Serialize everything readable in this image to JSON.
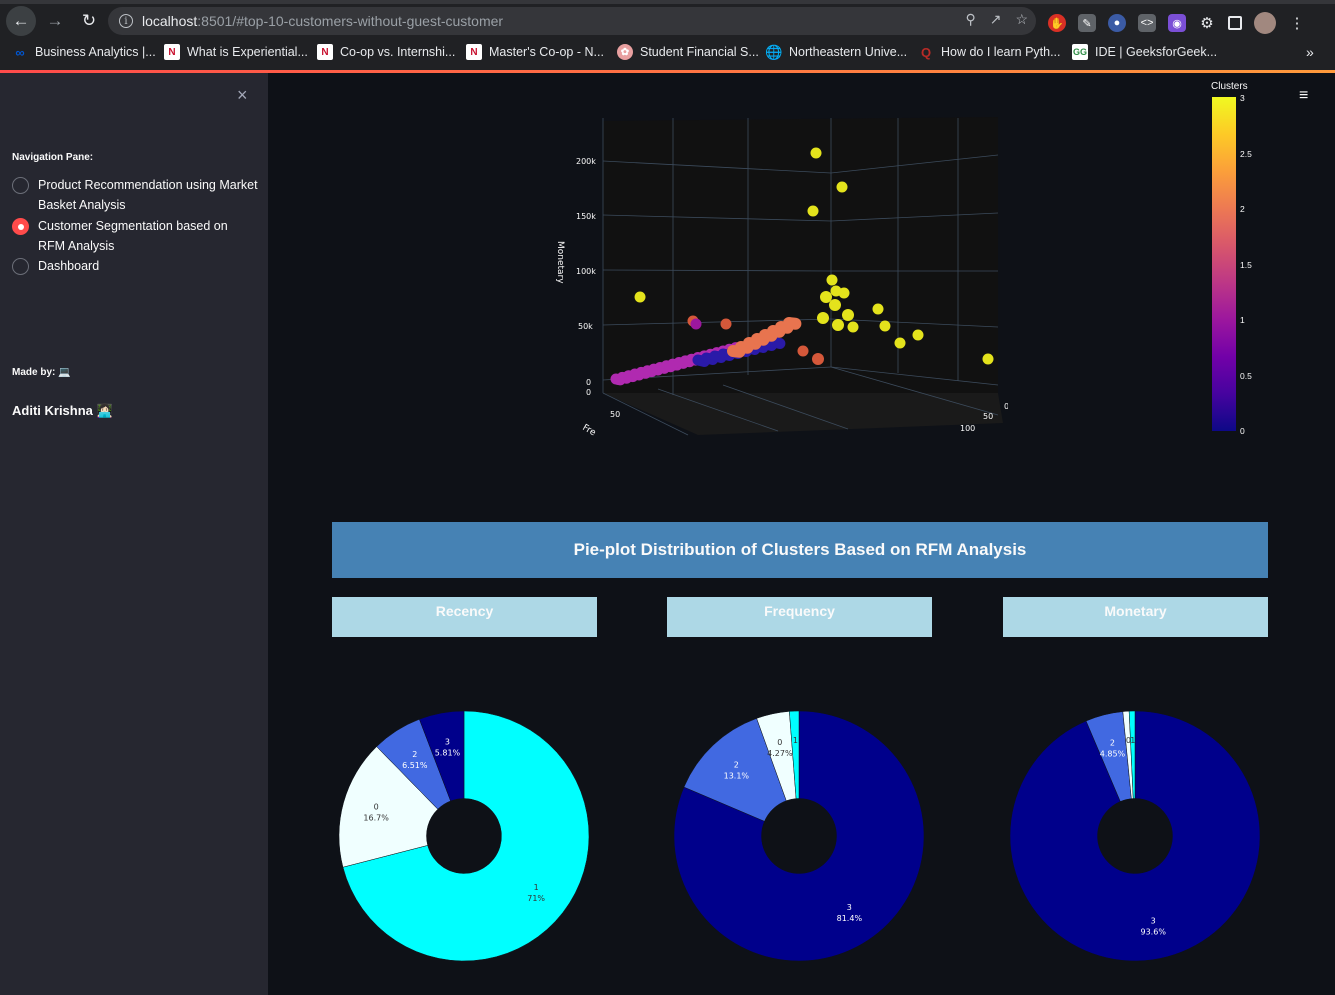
{
  "browser": {
    "url_host": "localhost",
    "url_rest": ":8501/#top-10-customers-without-guest-customer",
    "bookmarks": [
      {
        "label": "Business Analytics |...",
        "icon": "coursera-icon",
        "color": "#0056d2"
      },
      {
        "label": "What is Experiential...",
        "icon": "northeastern-icon",
        "color": "#c8102e"
      },
      {
        "label": "Co-op vs. Internshi...",
        "icon": "northeastern-icon",
        "color": "#c8102e"
      },
      {
        "label": "Master's Co-op - N...",
        "icon": "northeastern-icon",
        "color": "#c8102e"
      },
      {
        "label": "Student Financial S...",
        "icon": "seal-icon",
        "color": "#e8a0a0"
      },
      {
        "label": "Northeastern Unive...",
        "icon": "globe-icon",
        "color": "#9aa0a6"
      },
      {
        "label": "How do I learn Pyth...",
        "icon": "quora-icon",
        "color": "#b92b27"
      },
      {
        "label": "IDE | GeeksforGeek...",
        "icon": "gfg-icon",
        "color": "#2f8d46"
      }
    ],
    "more": "»"
  },
  "sidebar": {
    "close": "×",
    "nav_label": "Navigation Pane:",
    "options": [
      {
        "label": "Product Recommendation using Market Basket Analysis",
        "selected": false
      },
      {
        "label": "Customer Segmentation based on RFM Analysis",
        "selected": true
      },
      {
        "label": "Dashboard",
        "selected": false
      }
    ],
    "made_by": "Made by: 💻",
    "author": "Aditi Krishna 👩🏻‍💻"
  },
  "main": {
    "menu": "≡",
    "scatter3d": {
      "z_axis_title": "Monetary",
      "z_ticks": [
        "200k",
        "150k",
        "100k",
        "50k",
        "0"
      ],
      "x_ticks": [
        "0",
        "50"
      ],
      "y_ticks": [
        "0",
        "50",
        "100"
      ],
      "x_axis_title": "Fre"
    },
    "colorbar": {
      "title": "Clusters",
      "ticks": [
        "3",
        "2.5",
        "2",
        "1.5",
        "1",
        "0.5",
        "0"
      ]
    },
    "banner": "Pie-plot Distribution of Clusters Based on RFM Analysis",
    "subheads": [
      "Recency",
      "Frequency",
      "Monetary"
    ]
  },
  "chart_data": [
    {
      "type": "pie",
      "title": "Recency",
      "labels": [
        "1",
        "0",
        "2",
        "3"
      ],
      "values": [
        71,
        16.7,
        6.51,
        5.81
      ],
      "text": [
        "71%",
        "16.7%",
        "6.51%",
        "5.81%"
      ],
      "colors": [
        "#00ffff",
        "#f0ffff",
        "#4169e1",
        "#00008b"
      ],
      "hole": 0.3
    },
    {
      "type": "pie",
      "title": "Frequency",
      "labels": [
        "3",
        "2",
        "0",
        "1"
      ],
      "values": [
        81.4,
        13.1,
        4.27,
        1.23
      ],
      "text": [
        "81.4%",
        "13.1%",
        "4.27%",
        ""
      ],
      "colors": [
        "#00008b",
        "#4169e1",
        "#f0ffff",
        "#00ffff"
      ],
      "hole": 0.3
    },
    {
      "type": "pie",
      "title": "Monetary",
      "labels": [
        "3",
        "2",
        "0",
        "1"
      ],
      "values": [
        93.6,
        4.85,
        0.8,
        0.75
      ],
      "text": [
        "93.6%",
        "4.85%",
        "",
        ""
      ],
      "colors": [
        "#00008b",
        "#4169e1",
        "#f0ffff",
        "#00ffff"
      ],
      "hole": 0.3
    }
  ]
}
